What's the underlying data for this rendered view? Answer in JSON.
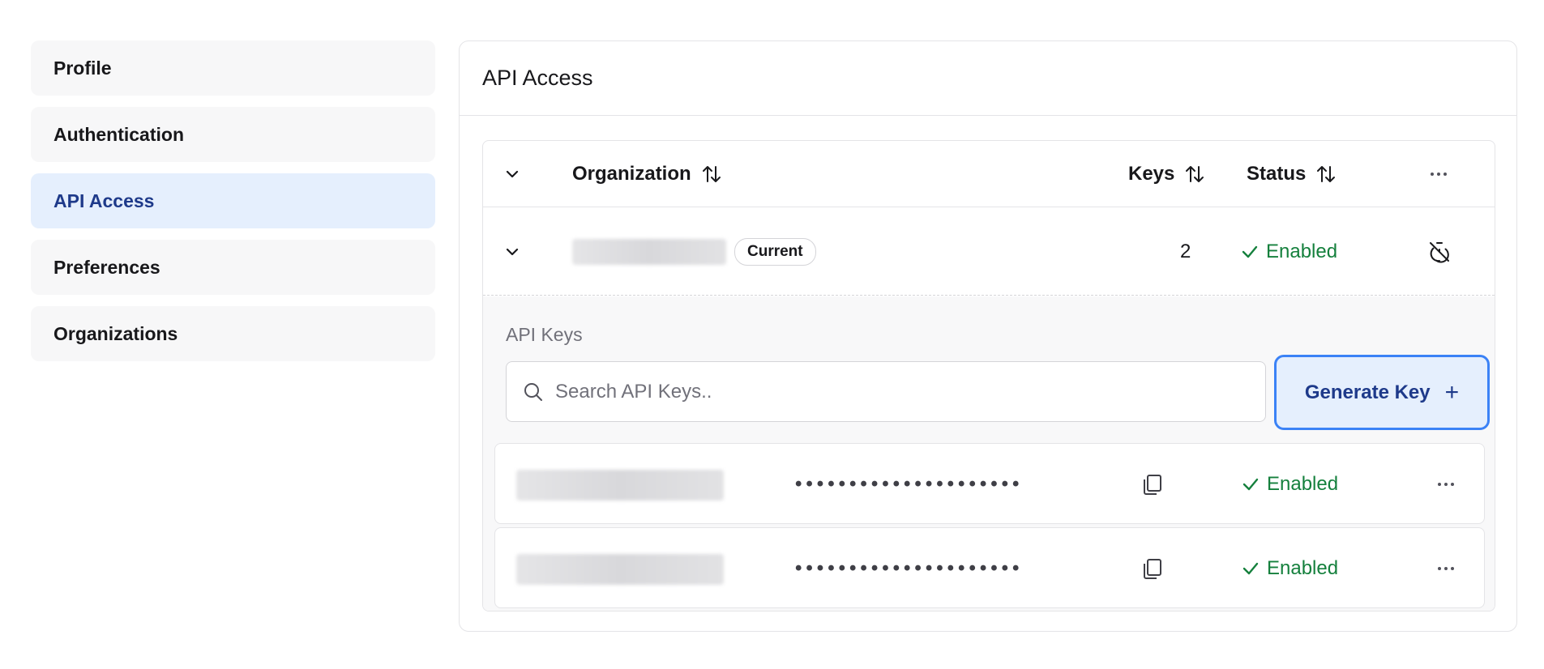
{
  "sidebar": {
    "items": [
      {
        "label": "Profile",
        "active": false
      },
      {
        "label": "Authentication",
        "active": false
      },
      {
        "label": "API Access",
        "active": true
      },
      {
        "label": "Preferences",
        "active": false
      },
      {
        "label": "Organizations",
        "active": false
      }
    ]
  },
  "panel": {
    "title": "API Access",
    "table": {
      "headers": {
        "organization": "Organization",
        "keys": "Keys",
        "status": "Status"
      },
      "org_row": {
        "badge": "Current",
        "keys_count": "2",
        "status": "Enabled"
      },
      "api_keys": {
        "section_label": "API Keys",
        "search_placeholder": "Search API Keys..",
        "generate_label": "Generate Key",
        "generate_icon": "+",
        "rows": [
          {
            "masked": "•••••••••••••••••••••",
            "status": "Enabled"
          },
          {
            "masked": "•••••••••••••••••••••",
            "status": "Enabled"
          }
        ]
      }
    }
  },
  "colors": {
    "accent": "#3b82f6",
    "accent_text": "#1e3a8a",
    "active_bg": "#e5effd",
    "status_green": "#15803d"
  }
}
